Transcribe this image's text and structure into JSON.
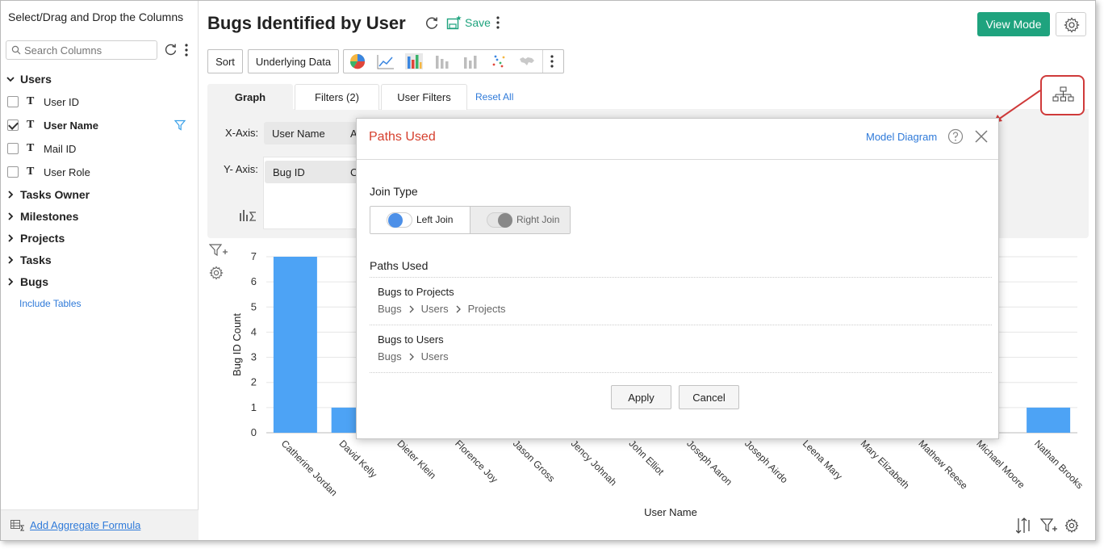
{
  "sidebar": {
    "title": "Select/Drag and Drop the Columns",
    "search_placeholder": "Search Columns",
    "groups": [
      {
        "label": "Users",
        "expanded": true
      },
      {
        "label": "Tasks Owner"
      },
      {
        "label": "Milestones"
      },
      {
        "label": "Projects"
      },
      {
        "label": "Tasks"
      },
      {
        "label": "Bugs"
      }
    ],
    "columns": [
      {
        "type": "T",
        "label": "User ID",
        "checked": false
      },
      {
        "type": "T",
        "label": "User Name",
        "checked": true
      },
      {
        "type": "T",
        "label": "Mail ID",
        "checked": false
      },
      {
        "type": "T",
        "label": "User Role",
        "checked": false
      }
    ],
    "include_tables": "Include Tables",
    "add_aggregate": "Add Aggregate Formula"
  },
  "header": {
    "title": "Bugs Identified by User",
    "save": "Save",
    "view_mode": "View Mode"
  },
  "toolbar": {
    "sort": "Sort",
    "underlying_data": "Underlying Data"
  },
  "tabs": [
    {
      "label": "Graph",
      "active": true
    },
    {
      "label": "Filters  (2)"
    },
    {
      "label": "User Filters"
    }
  ],
  "reset_all": "Reset All",
  "axes": {
    "x_label": "X-Axis:",
    "x_value": "User Name",
    "x_extra": "A",
    "y_label": "Y- Axis:",
    "y_value": "Bug ID",
    "y_extra": "C"
  },
  "colors": {
    "accent": "#1fa37e",
    "bar": "#4da3f5",
    "link": "#2f7ad9",
    "modal_title": "#d6402e",
    "highlight": "#cf3a3a"
  },
  "chart_data": {
    "type": "bar",
    "xlabel": "User Name",
    "ylabel": "Bug ID Count",
    "ylim": [
      0,
      7
    ],
    "yticks": [
      "0",
      "1",
      "2",
      "3",
      "4",
      "5",
      "6",
      "7"
    ],
    "categories": [
      "Catherine Jordan",
      "David Kelly",
      "Dieter Klein",
      "Florence Joy",
      "Jason Gross",
      "Jency Johnah",
      "John Elliot",
      "Joseph Aaron",
      "Joseph Airdo",
      "Leena Mary",
      "Mary Elizabeth",
      "Mathew Reese",
      "Michael Moore",
      "Nathan Brooks"
    ],
    "values": [
      7,
      1,
      null,
      null,
      null,
      null,
      null,
      null,
      null,
      null,
      null,
      null,
      null,
      1
    ]
  },
  "modal": {
    "title": "Paths Used",
    "model_diagram": "Model Diagram",
    "join_type_label": "Join Type",
    "left_join": "Left Join",
    "right_join": "Right Join",
    "selected_join": "Left Join",
    "paths_label": "Paths Used",
    "paths": [
      {
        "title": "Bugs to Projects",
        "steps": [
          "Bugs",
          "Users",
          "Projects"
        ]
      },
      {
        "title": "Bugs to Users",
        "steps": [
          "Bugs",
          "Users"
        ]
      }
    ],
    "apply": "Apply",
    "cancel": "Cancel"
  }
}
